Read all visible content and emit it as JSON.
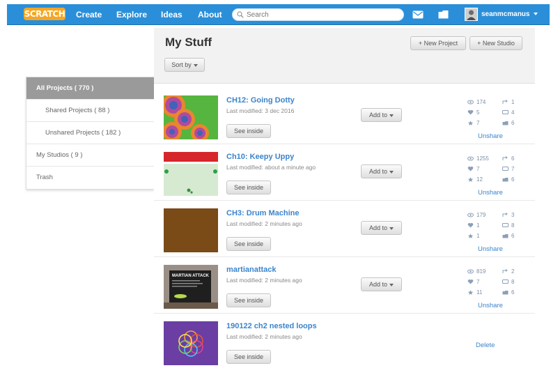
{
  "nav": {
    "logo": "SCRATCH",
    "create": "Create",
    "explore": "Explore",
    "ideas": "Ideas",
    "about": "About",
    "search_placeholder": "Search",
    "username": "seanmcmanus"
  },
  "header": {
    "title": "My Stuff",
    "new_project": "+ New Project",
    "new_studio": "+ New Studio",
    "sort_by": "Sort by"
  },
  "sidebar": {
    "items": [
      {
        "label": "All Projects ( 770 )"
      },
      {
        "label": "Shared Projects ( 88 )"
      },
      {
        "label": "Unshared Projects ( 182 )"
      },
      {
        "label": "My Studios ( 9 )"
      },
      {
        "label": "Trash"
      }
    ]
  },
  "projects": [
    {
      "name": "CH12: Going Dotty",
      "modified": "Last modified: 3 dec 2016",
      "see_inside": "See inside",
      "add_to": "Add to",
      "views": "174",
      "loves": "5",
      "favorites": "7",
      "remixes": "1",
      "comments": "4",
      "studios": "6",
      "action": "Unshare"
    },
    {
      "name": "Ch10: Keepy Uppy",
      "modified": "Last modified: about a minute ago",
      "see_inside": "See inside",
      "add_to": "Add to",
      "views": "1255",
      "loves": "7",
      "favorites": "12",
      "remixes": "6",
      "comments": "7",
      "studios": "6",
      "action": "Unshare"
    },
    {
      "name": "CH3: Drum Machine",
      "modified": "Last modified: 2 minutes ago",
      "see_inside": "See inside",
      "add_to": "Add to",
      "views": "179",
      "loves": "1",
      "favorites": "1",
      "remixes": "3",
      "comments": "8",
      "studios": "6",
      "action": "Unshare"
    },
    {
      "name": "martianattack",
      "modified": "Last modified: 2 minutes ago",
      "see_inside": "See inside",
      "add_to": "Add to",
      "views": "819",
      "loves": "7",
      "favorites": "11",
      "remixes": "2",
      "comments": "8",
      "studios": "6",
      "action": "Unshare"
    },
    {
      "name": "190122 ch2 nested loops",
      "modified": "Last modified: 2 minutes ago",
      "see_inside": "See inside",
      "action": "Delete"
    }
  ],
  "thumb_text": {
    "martian_title": "MARTIAN ATTACK"
  },
  "colors": {
    "topbar": "#2a8fd8",
    "link": "#3b84cc",
    "logo": "#f6a623",
    "sidebar_active": "#9a9a9a"
  }
}
